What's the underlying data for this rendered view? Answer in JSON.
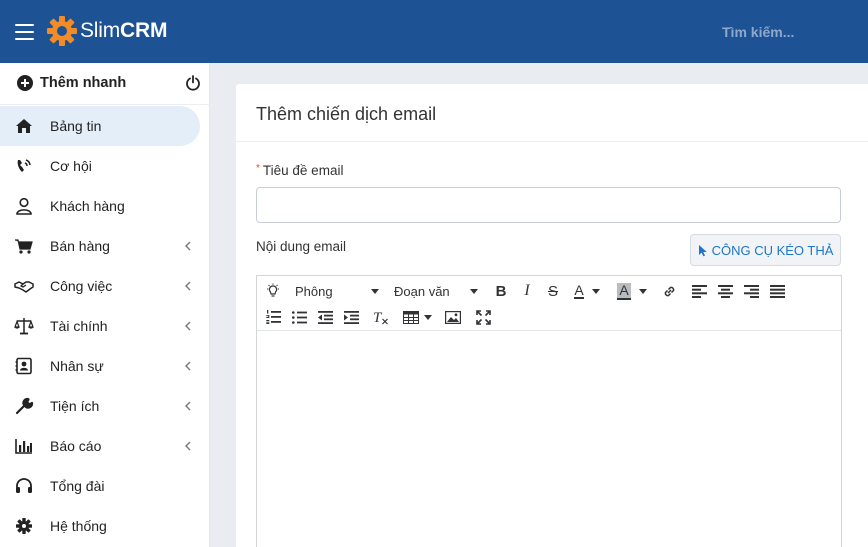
{
  "header": {
    "brand_light": "Slim",
    "brand_bold": "CRM",
    "search_placeholder": "Tìm kiếm...",
    "bar_color": "#1d5294",
    "logo_color": "#f28c28"
  },
  "sidebar": {
    "quick_add_label": "Thêm nhanh",
    "items": [
      {
        "label": "Bảng tin",
        "icon": "home-icon",
        "active": true,
        "submenu": false
      },
      {
        "label": "Cơ hội",
        "icon": "phone-ringing-icon",
        "active": false,
        "submenu": false
      },
      {
        "label": "Khách hàng",
        "icon": "user-icon",
        "active": false,
        "submenu": false
      },
      {
        "label": "Bán hàng",
        "icon": "cart-icon",
        "active": false,
        "submenu": true
      },
      {
        "label": "Công việc",
        "icon": "handshake-icon",
        "active": false,
        "submenu": true
      },
      {
        "label": "Tài chính",
        "icon": "scale-icon",
        "active": false,
        "submenu": true
      },
      {
        "label": "Nhân sự",
        "icon": "contact-card-icon",
        "active": false,
        "submenu": true
      },
      {
        "label": "Tiện ích",
        "icon": "wrench-icon",
        "active": false,
        "submenu": true
      },
      {
        "label": "Báo cáo",
        "icon": "bar-chart-icon",
        "active": false,
        "submenu": true
      },
      {
        "label": "Tổng đài",
        "icon": "headset-icon",
        "active": false,
        "submenu": false
      },
      {
        "label": "Hệ thống",
        "icon": "gear-icon",
        "active": false,
        "submenu": false
      }
    ]
  },
  "form": {
    "title": "Thêm chiến dịch email",
    "subject_label": "Tiêu đề email",
    "subject_required_mark": "*",
    "subject_value": "",
    "content_label": "Nội dung email",
    "dnd_button_label": "CÔNG CỤ KÉO THẢ",
    "accent_color": "#1b77c9"
  },
  "editor": {
    "font_dropdown": "Phông",
    "format_dropdown": "Đoạn văn",
    "text_color_glyph": "A",
    "bg_color_glyph": "A"
  }
}
